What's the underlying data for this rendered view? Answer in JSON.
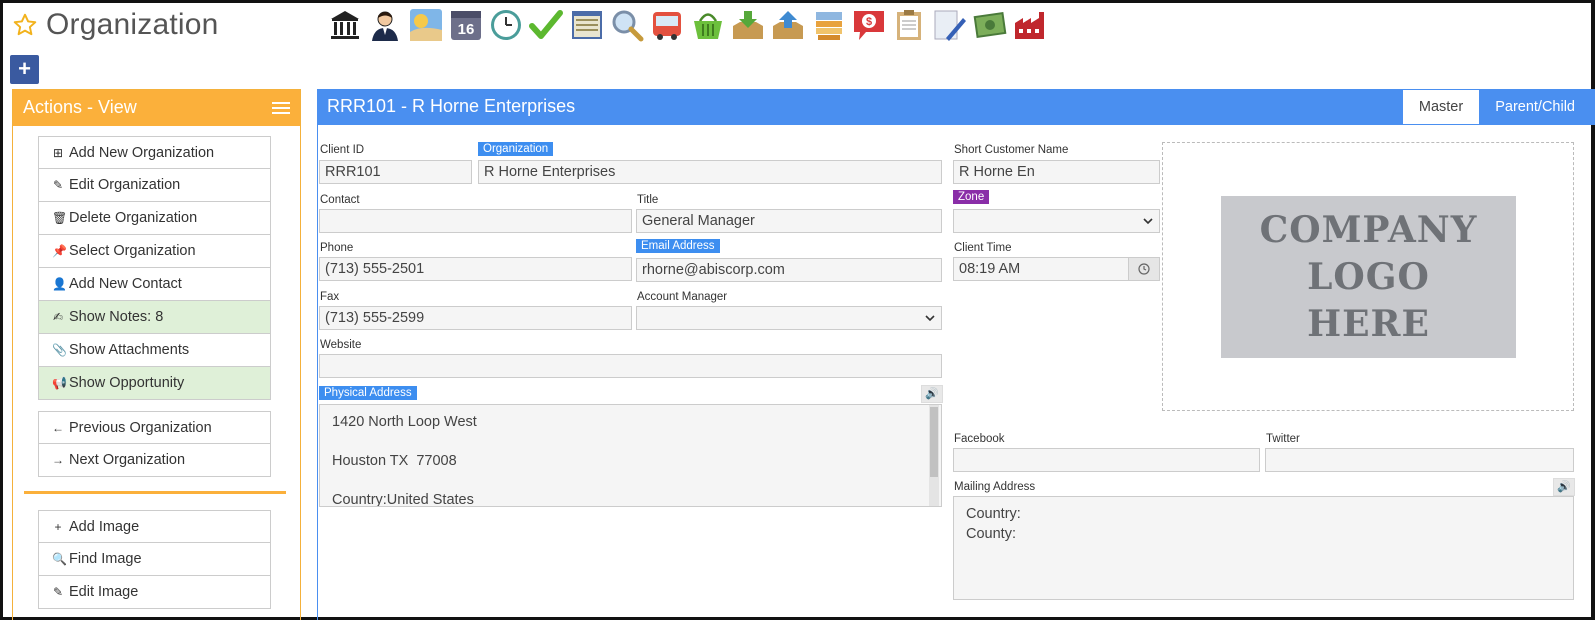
{
  "page": {
    "title": "Organization"
  },
  "toolbar": {
    "icons": [
      "bank-icon",
      "person-icon",
      "sunrise-icon",
      "calendar-16-icon",
      "clock-icon",
      "checkmark-icon",
      "window-icon",
      "magnifier-icon",
      "bus-icon",
      "basket-icon",
      "inbox-download-icon",
      "inbox-upload-icon",
      "stack-icon",
      "dollar-chat-icon",
      "clipboard-icon",
      "document-pen-icon",
      "money-icon",
      "factory-icon"
    ],
    "calendar_number": "16"
  },
  "add_button": {
    "label": "+"
  },
  "actions": {
    "header": "Actions - View",
    "group1": [
      {
        "label": "Add New Organization",
        "icon": "plus-square-icon",
        "glyph": "⊞"
      },
      {
        "label": "Edit Organization",
        "icon": "pencil-icon",
        "glyph": "✎"
      },
      {
        "label": "Delete Organization",
        "icon": "trash-icon",
        "glyph": "🗑"
      },
      {
        "label": "Select Organization",
        "icon": "pushpin-icon",
        "glyph": "📌"
      },
      {
        "label": "Add New Contact",
        "icon": "user-icon",
        "glyph": "👤"
      },
      {
        "label": "Show Notes: 8",
        "icon": "edit-note-icon",
        "glyph": "✍"
      },
      {
        "label": "Show Attachments",
        "icon": "paperclip-icon",
        "glyph": "📎"
      },
      {
        "label": "Show Opportunity",
        "icon": "bullhorn-icon",
        "glyph": "📢"
      }
    ],
    "group2": [
      {
        "label": "Previous Organization",
        "icon": "arrow-left-icon",
        "glyph": "←"
      },
      {
        "label": "Next Organization",
        "icon": "arrow-right-icon",
        "glyph": "→"
      }
    ],
    "group3": [
      {
        "label": "Add Image",
        "icon": "plus-icon",
        "glyph": "+"
      },
      {
        "label": "Find Image",
        "icon": "search-icon",
        "glyph": "🔍"
      },
      {
        "label": "Edit Image",
        "icon": "pencil-icon",
        "glyph": "✎"
      }
    ]
  },
  "main": {
    "header": "RRR101 - R Horne Enterprises",
    "tabs": [
      {
        "label": "Master"
      },
      {
        "label": "Parent/Child"
      }
    ]
  },
  "form": {
    "client_id": {
      "label": "Client ID",
      "value": "RRR101"
    },
    "organization": {
      "label": "Organization",
      "value": "R Horne Enterprises"
    },
    "short_name": {
      "label": "Short Customer Name",
      "value": "R Horne En"
    },
    "contact": {
      "label": "Contact",
      "value": ""
    },
    "title": {
      "label": "Title",
      "value": "General Manager"
    },
    "zone": {
      "label": "Zone",
      "value": ""
    },
    "phone": {
      "label": "Phone",
      "value": "(713) 555-2501"
    },
    "email": {
      "label": "Email Address",
      "value": "rhorne@abiscorp.com"
    },
    "client_time": {
      "label": "Client Time",
      "value": "08:19 AM"
    },
    "fax": {
      "label": "Fax",
      "value": "(713) 555-2599"
    },
    "account_manager": {
      "label": "Account Manager",
      "value": ""
    },
    "website": {
      "label": "Website",
      "value": ""
    },
    "physical_address": {
      "label": "Physical Address",
      "value": "1420 North Loop West\n\nHouston TX  77008\n\nCountry:United States"
    },
    "facebook": {
      "label": "Facebook",
      "value": ""
    },
    "twitter": {
      "label": "Twitter",
      "value": ""
    },
    "mailing_address": {
      "label": "Mailing Address",
      "value": "Country:\nCounty:"
    }
  },
  "logo": {
    "line1": "COMPANY",
    "line2": "LOGO",
    "line3": "HERE"
  },
  "colors": {
    "accent_orange": "#fbb03b",
    "accent_blue": "#4a8ff0",
    "zone_purple": "#8a2ea8",
    "notes_green": "#dff0d8"
  }
}
